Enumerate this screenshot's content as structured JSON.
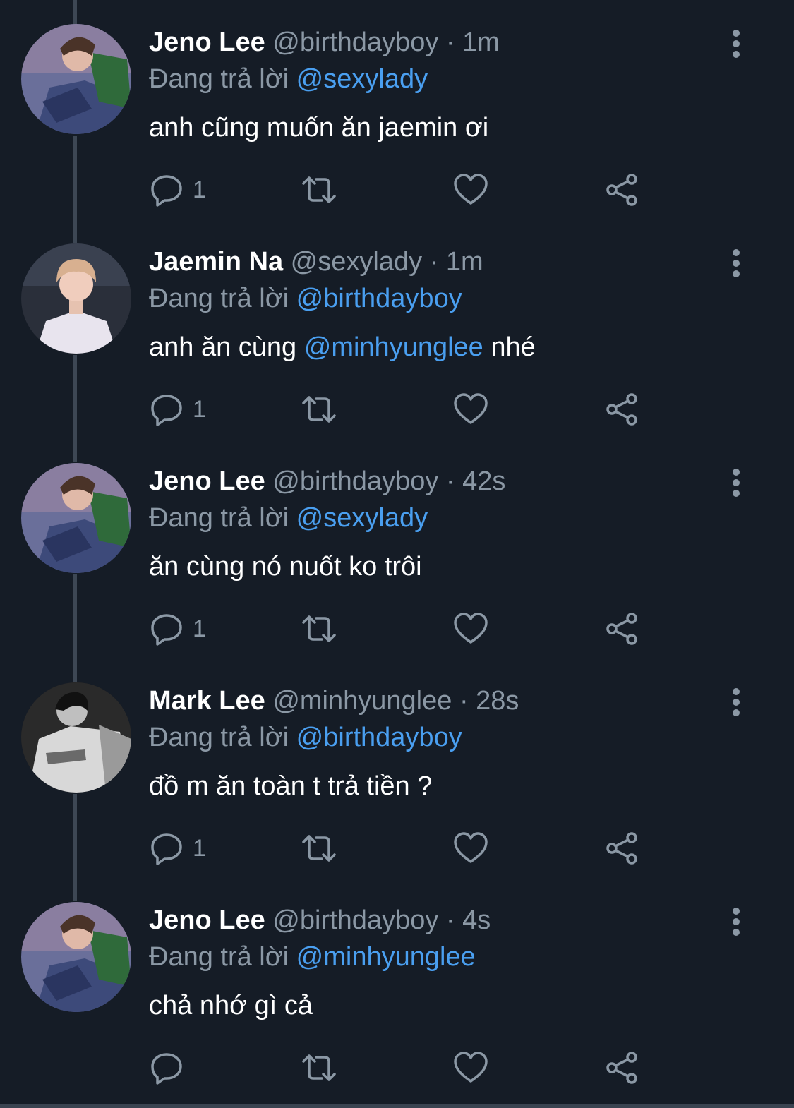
{
  "replying_label": "Đang trả lời",
  "tweets": [
    {
      "name": "Jeno Lee",
      "handle": "@birthdayboy",
      "time": "1m",
      "reply_to": "@sexylady",
      "text_before": "anh cũng muốn ăn jaemin ơi",
      "text_mention": "",
      "text_after": "",
      "reply_count": "1",
      "avatar": "jeno"
    },
    {
      "name": "Jaemin Na",
      "handle": "@sexylady",
      "time": "1m",
      "reply_to": "@birthdayboy",
      "text_before": "anh ăn cùng ",
      "text_mention": "@minhyunglee",
      "text_after": " nhé",
      "reply_count": "1",
      "avatar": "jaemin"
    },
    {
      "name": "Jeno Lee",
      "handle": "@birthdayboy",
      "time": "42s",
      "reply_to": "@sexylady",
      "text_before": "ăn cùng nó nuốt ko trôi",
      "text_mention": "",
      "text_after": "",
      "reply_count": "1",
      "avatar": "jeno"
    },
    {
      "name": "Mark Lee",
      "handle": "@minhyunglee",
      "time": "28s",
      "reply_to": "@birthdayboy",
      "text_before": "đồ m ăn toàn t trả tiền ?",
      "text_mention": "",
      "text_after": "",
      "reply_count": "1",
      "avatar": "mark"
    },
    {
      "name": "Jeno Lee",
      "handle": "@birthdayboy",
      "time": "4s",
      "reply_to": "@minhyunglee",
      "text_before": "chả nhớ gì cả",
      "text_mention": "",
      "text_after": "",
      "reply_count": "",
      "avatar": "jeno"
    }
  ],
  "icons": {
    "reply": "reply-bubble-icon",
    "retweet": "retweet-icon",
    "like": "heart-icon",
    "share": "share-icon",
    "more": "more-vertical-icon"
  },
  "colors": {
    "background": "#151c26",
    "secondary_text": "#8b98a5",
    "mention": "#4a9ff0",
    "thread_line": "#3d4754"
  }
}
